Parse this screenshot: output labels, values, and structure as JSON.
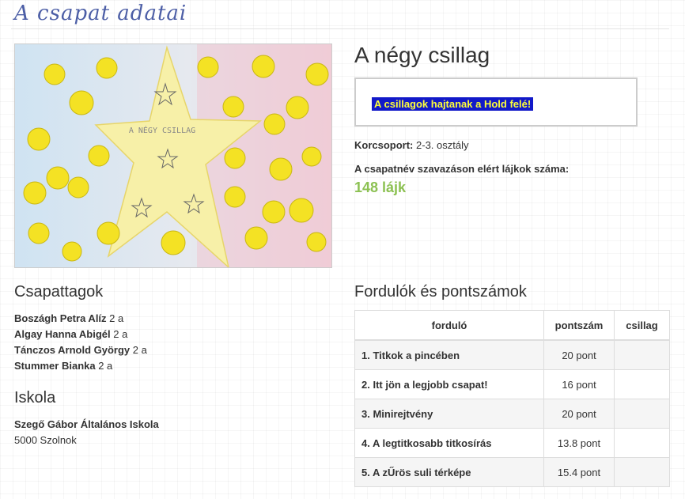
{
  "page": {
    "title": "A csapat adatai"
  },
  "team": {
    "name": "A négy csillag",
    "motto": "A csillagok hajtanak a Hold felé!",
    "age_group_label": "Korcsoport:",
    "age_group_value": "2-3. osztály",
    "likes_label": "A csapatnév szavazáson elért lájkok száma:",
    "likes_value": "148 lájk",
    "drawing_caption": "A NÉGY CSILLAG"
  },
  "members": {
    "heading": "Csapattagok",
    "items": [
      {
        "name": "Boszágh Petra Alíz",
        "class": "2 a"
      },
      {
        "name": "Algay Hanna Abigél",
        "class": "2 a"
      },
      {
        "name": "Tánczos Arnold György",
        "class": "2 a"
      },
      {
        "name": "Stummer Bianka",
        "class": "2 a"
      }
    ]
  },
  "school": {
    "heading": "Iskola",
    "name": "Szegő Gábor Általános Iskola",
    "address": "5000 Szolnok"
  },
  "rounds": {
    "heading": "Fordulók és pontszámok",
    "columns": [
      "forduló",
      "pontszám",
      "csillag"
    ],
    "rows": [
      {
        "name": "1. Titkok a pincében",
        "score": "20 pont",
        "star": ""
      },
      {
        "name": "2. Itt jön a legjobb csapat!",
        "score": "16 pont",
        "star": ""
      },
      {
        "name": "3. Minirejtvény",
        "score": "20 pont",
        "star": ""
      },
      {
        "name": "4. A legtitkosabb titkosírás",
        "score": "13.8 pont",
        "star": ""
      },
      {
        "name": "5. A zŰrös suli térképe",
        "score": "15.4 pont",
        "star": ""
      }
    ]
  },
  "colors": {
    "title": "#4c5ea6",
    "likes": "#8cc152",
    "motto_bg": "#1219c9",
    "motto_fg": "#ffff3a"
  }
}
